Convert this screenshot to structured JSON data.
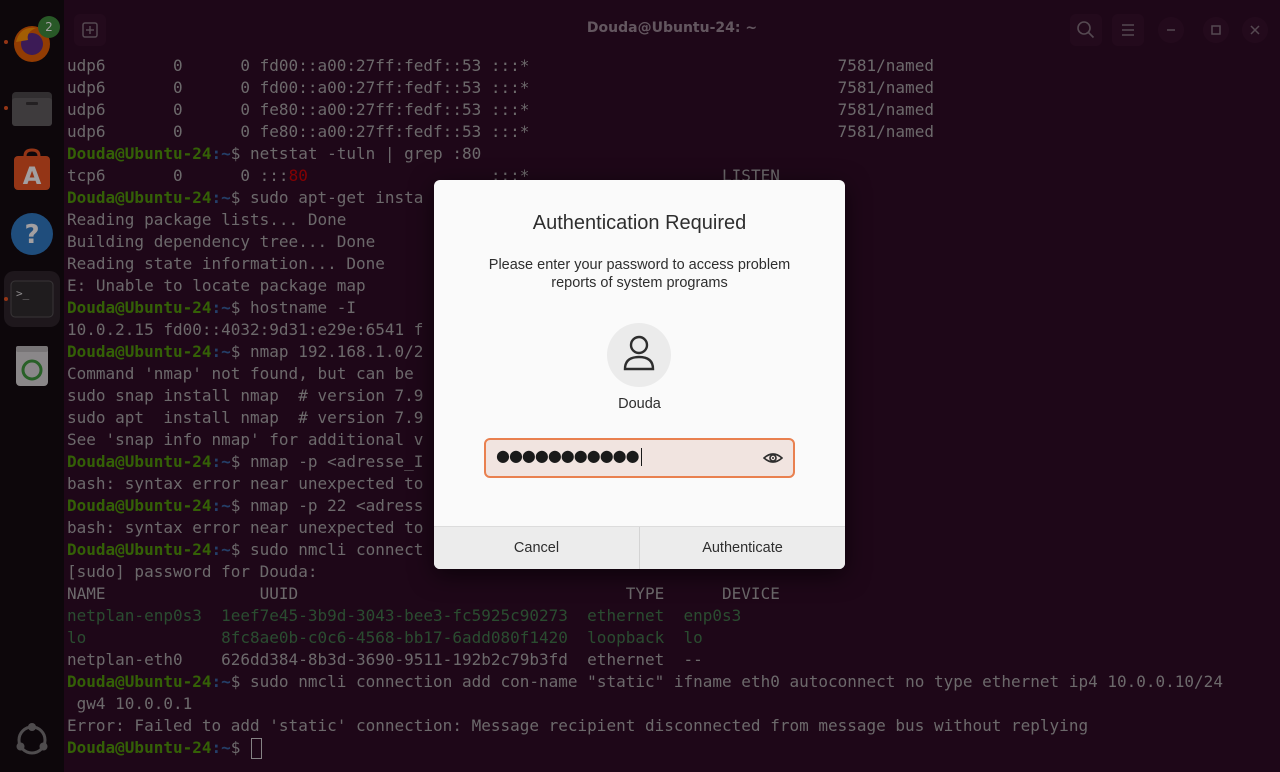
{
  "dock": {
    "firefox_badge": "2",
    "items": [
      "firefox-icon",
      "files-icon",
      "app-center-icon",
      "help-icon",
      "terminal-icon",
      "trash-icon",
      "ubuntu-logo-icon"
    ]
  },
  "terminal": {
    "title": "Douda@Ubuntu-24: ~",
    "user_host": "Douda@Ubuntu-24",
    "path_suffix": ":~",
    "lines": [
      {
        "type": "out",
        "text": "udp6       0      0 fd00::a00:27ff:fedf::53 :::*                                7581/named"
      },
      {
        "type": "out",
        "text": "udp6       0      0 fd00::a00:27ff:fedf::53 :::*                                7581/named"
      },
      {
        "type": "out",
        "text": "udp6       0      0 fe80::a00:27ff:fedf::53 :::*                                7581/named"
      },
      {
        "type": "out",
        "text": "udp6       0      0 fe80::a00:27ff:fedf::53 :::*                                7581/named"
      },
      {
        "type": "prompt",
        "cmd": "$ netstat -tuln | grep :80"
      },
      {
        "type": "port",
        "pre": "tcp6       0      0 :::",
        "red": "80",
        "post": "                   :::*                    LISTEN"
      },
      {
        "type": "prompt",
        "cmd": "$ sudo apt-get insta"
      },
      {
        "type": "out",
        "text": "Reading package lists... Done"
      },
      {
        "type": "out",
        "text": "Building dependency tree... Done"
      },
      {
        "type": "out",
        "text": "Reading state information... Done"
      },
      {
        "type": "out",
        "text": "E: Unable to locate package map"
      },
      {
        "type": "prompt",
        "cmd": "$ hostname -I"
      },
      {
        "type": "out",
        "text": "10.0.2.15 fd00::4032:9d31:e29e:6541 f"
      },
      {
        "type": "prompt",
        "cmd": "$ nmap 192.168.1.0/2"
      },
      {
        "type": "out",
        "text": "Command 'nmap' not found, but can be"
      },
      {
        "type": "out",
        "text": "sudo snap install nmap  # version 7.9"
      },
      {
        "type": "out",
        "text": "sudo apt  install nmap  # version 7.9"
      },
      {
        "type": "out",
        "text": "See 'snap info nmap' for additional v"
      },
      {
        "type": "prompt",
        "cmd": "$ nmap -p <adresse_I"
      },
      {
        "type": "out",
        "text": "bash: syntax error near unexpected to"
      },
      {
        "type": "prompt",
        "cmd": "$ nmap -p 22 <adress"
      },
      {
        "type": "out",
        "text": "bash: syntax error near unexpected to"
      },
      {
        "type": "prompt",
        "cmd": "$ sudo nmcli connect"
      },
      {
        "type": "out",
        "text": "[sudo] password for Douda:"
      },
      {
        "type": "out",
        "text": "NAME                UUID                                  TYPE      DEVICE"
      },
      {
        "type": "green",
        "text": "netplan-enp0s3  1eef7e45-3b9d-3043-bee3-fc5925c90273  ethernet  enp0s3"
      },
      {
        "type": "green",
        "text": "lo              8fc8ae0b-c0c6-4568-bb17-6add080f1420  loopback  lo"
      },
      {
        "type": "out",
        "text": "netplan-eth0    626dd384-8b3d-3690-9511-192b2c79b3fd  ethernet  --"
      },
      {
        "type": "prompt",
        "cmd": "$ sudo nmcli connection add con-name \"static\" ifname eth0 autoconnect no type ethernet ip4 10.0.0.10/24"
      },
      {
        "type": "out",
        "text": " gw4 10.0.0.1"
      },
      {
        "type": "out",
        "text": "Error: Failed to add 'static' connection: Message recipient disconnected from message bus without replying"
      },
      {
        "type": "prompt_cursor",
        "cmd": "$ "
      }
    ]
  },
  "dialog": {
    "title": "Authentication Required",
    "message": "Please enter your password to access problem reports of system programs",
    "username": "Douda",
    "password_mask": "●●●●●●●●●●●",
    "cancel_label": "Cancel",
    "authenticate_label": "Authenticate"
  },
  "colors": {
    "accent": "#e9804f",
    "terminal_bg": "#2b0a22",
    "prompt_user": "#4e9a06",
    "prompt_path": "#3465a4"
  }
}
